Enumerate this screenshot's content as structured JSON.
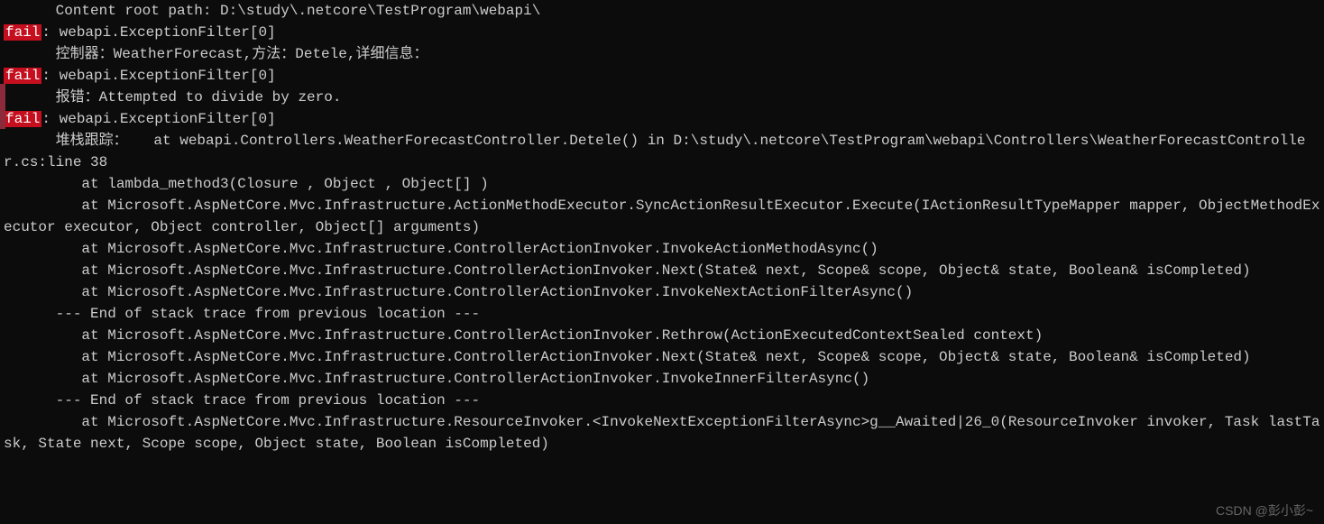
{
  "log": {
    "line0": "      Content root path: D:\\study\\.netcore\\TestProgram\\webapi\\",
    "fail_label": "fail",
    "line1_after": ": webapi.ExceptionFilter[0]",
    "line2": "      控制器：WeatherForecast,方法：Detele,详细信息：",
    "blank": "",
    "line4_after": ": webapi.ExceptionFilter[0]",
    "line5": "      报错：Attempted to divide by zero.",
    "line6_after": ": webapi.ExceptionFilter[0]",
    "line7": "      堆栈跟踪：   at webapi.Controllers.WeatherForecastController.Detele() in D:\\study\\.netcore\\TestProgram\\webapi\\Controllers\\WeatherForecastController.cs:line 38",
    "line8": "         at lambda_method3(Closure , Object , Object[] )",
    "line9": "         at Microsoft.AspNetCore.Mvc.Infrastructure.ActionMethodExecutor.SyncActionResultExecutor.Execute(IActionResultTypeMapper mapper, ObjectMethodExecutor executor, Object controller, Object[] arguments)",
    "line10": "         at Microsoft.AspNetCore.Mvc.Infrastructure.ControllerActionInvoker.InvokeActionMethodAsync()",
    "line11": "         at Microsoft.AspNetCore.Mvc.Infrastructure.ControllerActionInvoker.Next(State& next, Scope& scope, Object& state, Boolean& isCompleted)",
    "line12": "         at Microsoft.AspNetCore.Mvc.Infrastructure.ControllerActionInvoker.InvokeNextActionFilterAsync()",
    "line13": "      --- End of stack trace from previous location ---",
    "line14": "         at Microsoft.AspNetCore.Mvc.Infrastructure.ControllerActionInvoker.Rethrow(ActionExecutedContextSealed context)",
    "line15": "         at Microsoft.AspNetCore.Mvc.Infrastructure.ControllerActionInvoker.Next(State& next, Scope& scope, Object& state, Boolean& isCompleted)",
    "line16": "         at Microsoft.AspNetCore.Mvc.Infrastructure.ControllerActionInvoker.InvokeInnerFilterAsync()",
    "line17": "      --- End of stack trace from previous location ---",
    "line18": "         at Microsoft.AspNetCore.Mvc.Infrastructure.ResourceInvoker.<InvokeNextExceptionFilterAsync>g__Awaited|26_0(ResourceInvoker invoker, Task lastTask, State next, Scope scope, Object state, Boolean isCompleted)"
  },
  "watermark": "CSDN @彭小彭~"
}
